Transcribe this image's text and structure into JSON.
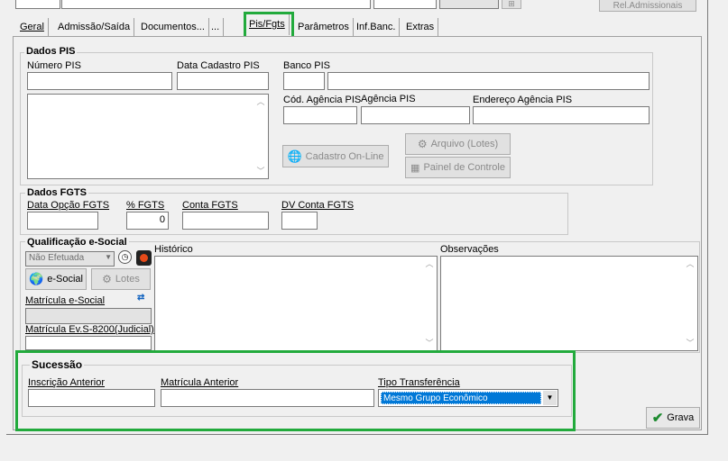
{
  "top_button": "Rel.Admissionais",
  "tabs": [
    {
      "label": "Geral"
    },
    {
      "label": "Admissão/Saída"
    },
    {
      "label": "Documentos..."
    },
    {
      "label": "..."
    },
    {
      "label": "Pis/Fgts"
    },
    {
      "label": "Parâmetros"
    },
    {
      "label": "Inf.Banc."
    },
    {
      "label": "Extras"
    }
  ],
  "dados_pis": {
    "title": "Dados PIS",
    "numero_pis": "Número PIS",
    "data_cadastro_pis": "Data Cadastro PIS",
    "banco_pis": "Banco PIS",
    "cod_agencia_pis": "Cód. Agência PIS",
    "agencia_pis": "Agência PIS",
    "endereco_agencia_pis": "Endereço Agência PIS",
    "cadastro_online": "Cadastro On-Line",
    "arquivo_lotes": "Arquivo (Lotes)",
    "painel_controle": "Painel de Controle"
  },
  "dados_fgts": {
    "title": "Dados FGTS",
    "data_opcao": "Data Opção FGTS",
    "percent_fgts": "% FGTS",
    "percent_value": "0",
    "conta_fgts": "Conta FGTS",
    "dv_conta": "DV Conta FGTS"
  },
  "qualificacao": {
    "title": "Qualificação e-Social",
    "status_value": "Não Efetuada",
    "esocial_button": "e-Social",
    "lotes_button": "Lotes",
    "matricula_esocial": "Matrícula e-Social",
    "matricula_ev": "Matrícula Ev.S-8200(Judicial)",
    "historico": "Histórico",
    "observacoes": "Observações"
  },
  "sucessao": {
    "title": "Sucessão",
    "inscricao_anterior": "Inscrição Anterior",
    "matricula_anterior": "Matrícula Anterior",
    "tipo_transferencia": "Tipo Transferência",
    "tipo_transferencia_value": "Mesmo Grupo Econômico"
  },
  "grava_button": "Grava",
  "colors": {
    "highlight": "#22aa3c",
    "selection": "#0078d7"
  }
}
